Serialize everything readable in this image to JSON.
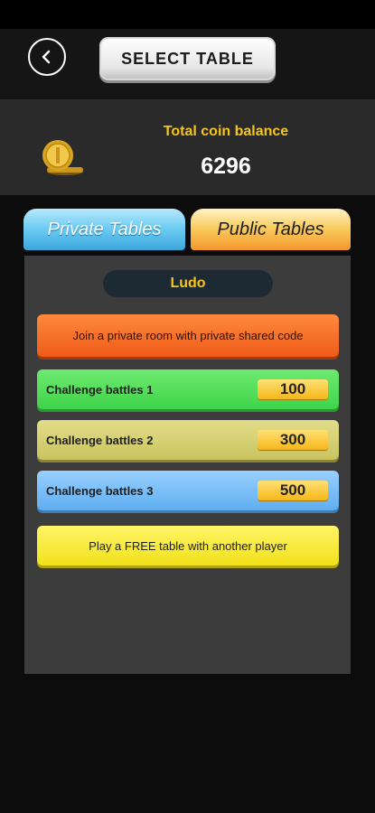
{
  "header": {
    "title": "SELECT TABLE",
    "back_icon": "chevron-left-icon"
  },
  "balance": {
    "label": "Total coin balance",
    "value": "6296",
    "icon": "coin-icon"
  },
  "tabs": [
    {
      "label": "Private Tables",
      "state": "inactive"
    },
    {
      "label": "Public Tables",
      "state": "selected"
    }
  ],
  "game": {
    "name": "Ludo"
  },
  "join_private": {
    "label": "Join a private room with private shared code"
  },
  "challenges": [
    {
      "label": "Challenge battles 1",
      "value": "100"
    },
    {
      "label": "Challenge battles 2",
      "value": "300"
    },
    {
      "label": "Challenge battles 3",
      "value": "500"
    }
  ],
  "free_table": {
    "label": "Play a FREE table with another player"
  },
  "colors": {
    "accent_gold": "#f5c518",
    "private_tab": "#6fcdf3",
    "public_tab": "#f9c95a",
    "join_button": "#ee5b18",
    "challenge_1": "#3fd34a",
    "challenge_2": "#c8c45f",
    "challenge_3": "#5faef0",
    "free_button": "#f1e11a"
  }
}
